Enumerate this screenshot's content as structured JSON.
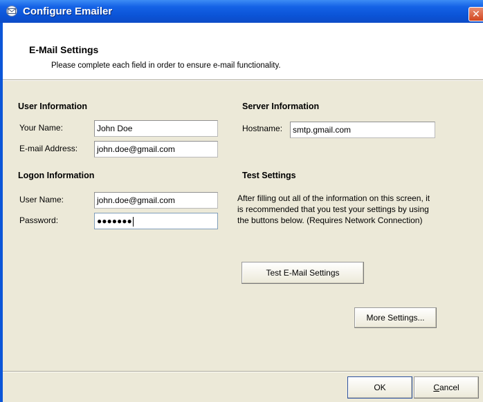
{
  "window": {
    "title": "Configure Emailer",
    "close_label": "✕"
  },
  "header": {
    "title": "E-Mail Settings",
    "description": "Please complete each field in order to ensure e-mail functionality."
  },
  "user_info": {
    "heading": "User Information",
    "name_label": "Your Name:",
    "name_value": "John Doe",
    "email_label": "E-mail Address:",
    "email_value": "john.doe@gmail.com"
  },
  "logon_info": {
    "heading": "Logon Information",
    "username_label": "User Name:",
    "username_value": "john.doe@gmail.com",
    "password_label": "Password:",
    "password_value": "●●●●●●●"
  },
  "server_info": {
    "heading": "Server Information",
    "hostname_label": "Hostname:",
    "hostname_value": "smtp.gmail.com"
  },
  "test_settings": {
    "heading": "Test Settings",
    "description": "After filling out all of the information on this screen, it is recommended that you test your settings by using the buttons below.  (Requires Network Connection)",
    "test_button": "Test E-Mail Settings"
  },
  "buttons": {
    "more_settings": "More Settings...",
    "ok": "OK",
    "cancel_first": "C",
    "cancel_rest": "ancel"
  },
  "colors": {
    "titlebar": "#0b53d6",
    "dialog_bg": "#ece9d8",
    "close": "#d2461f"
  }
}
